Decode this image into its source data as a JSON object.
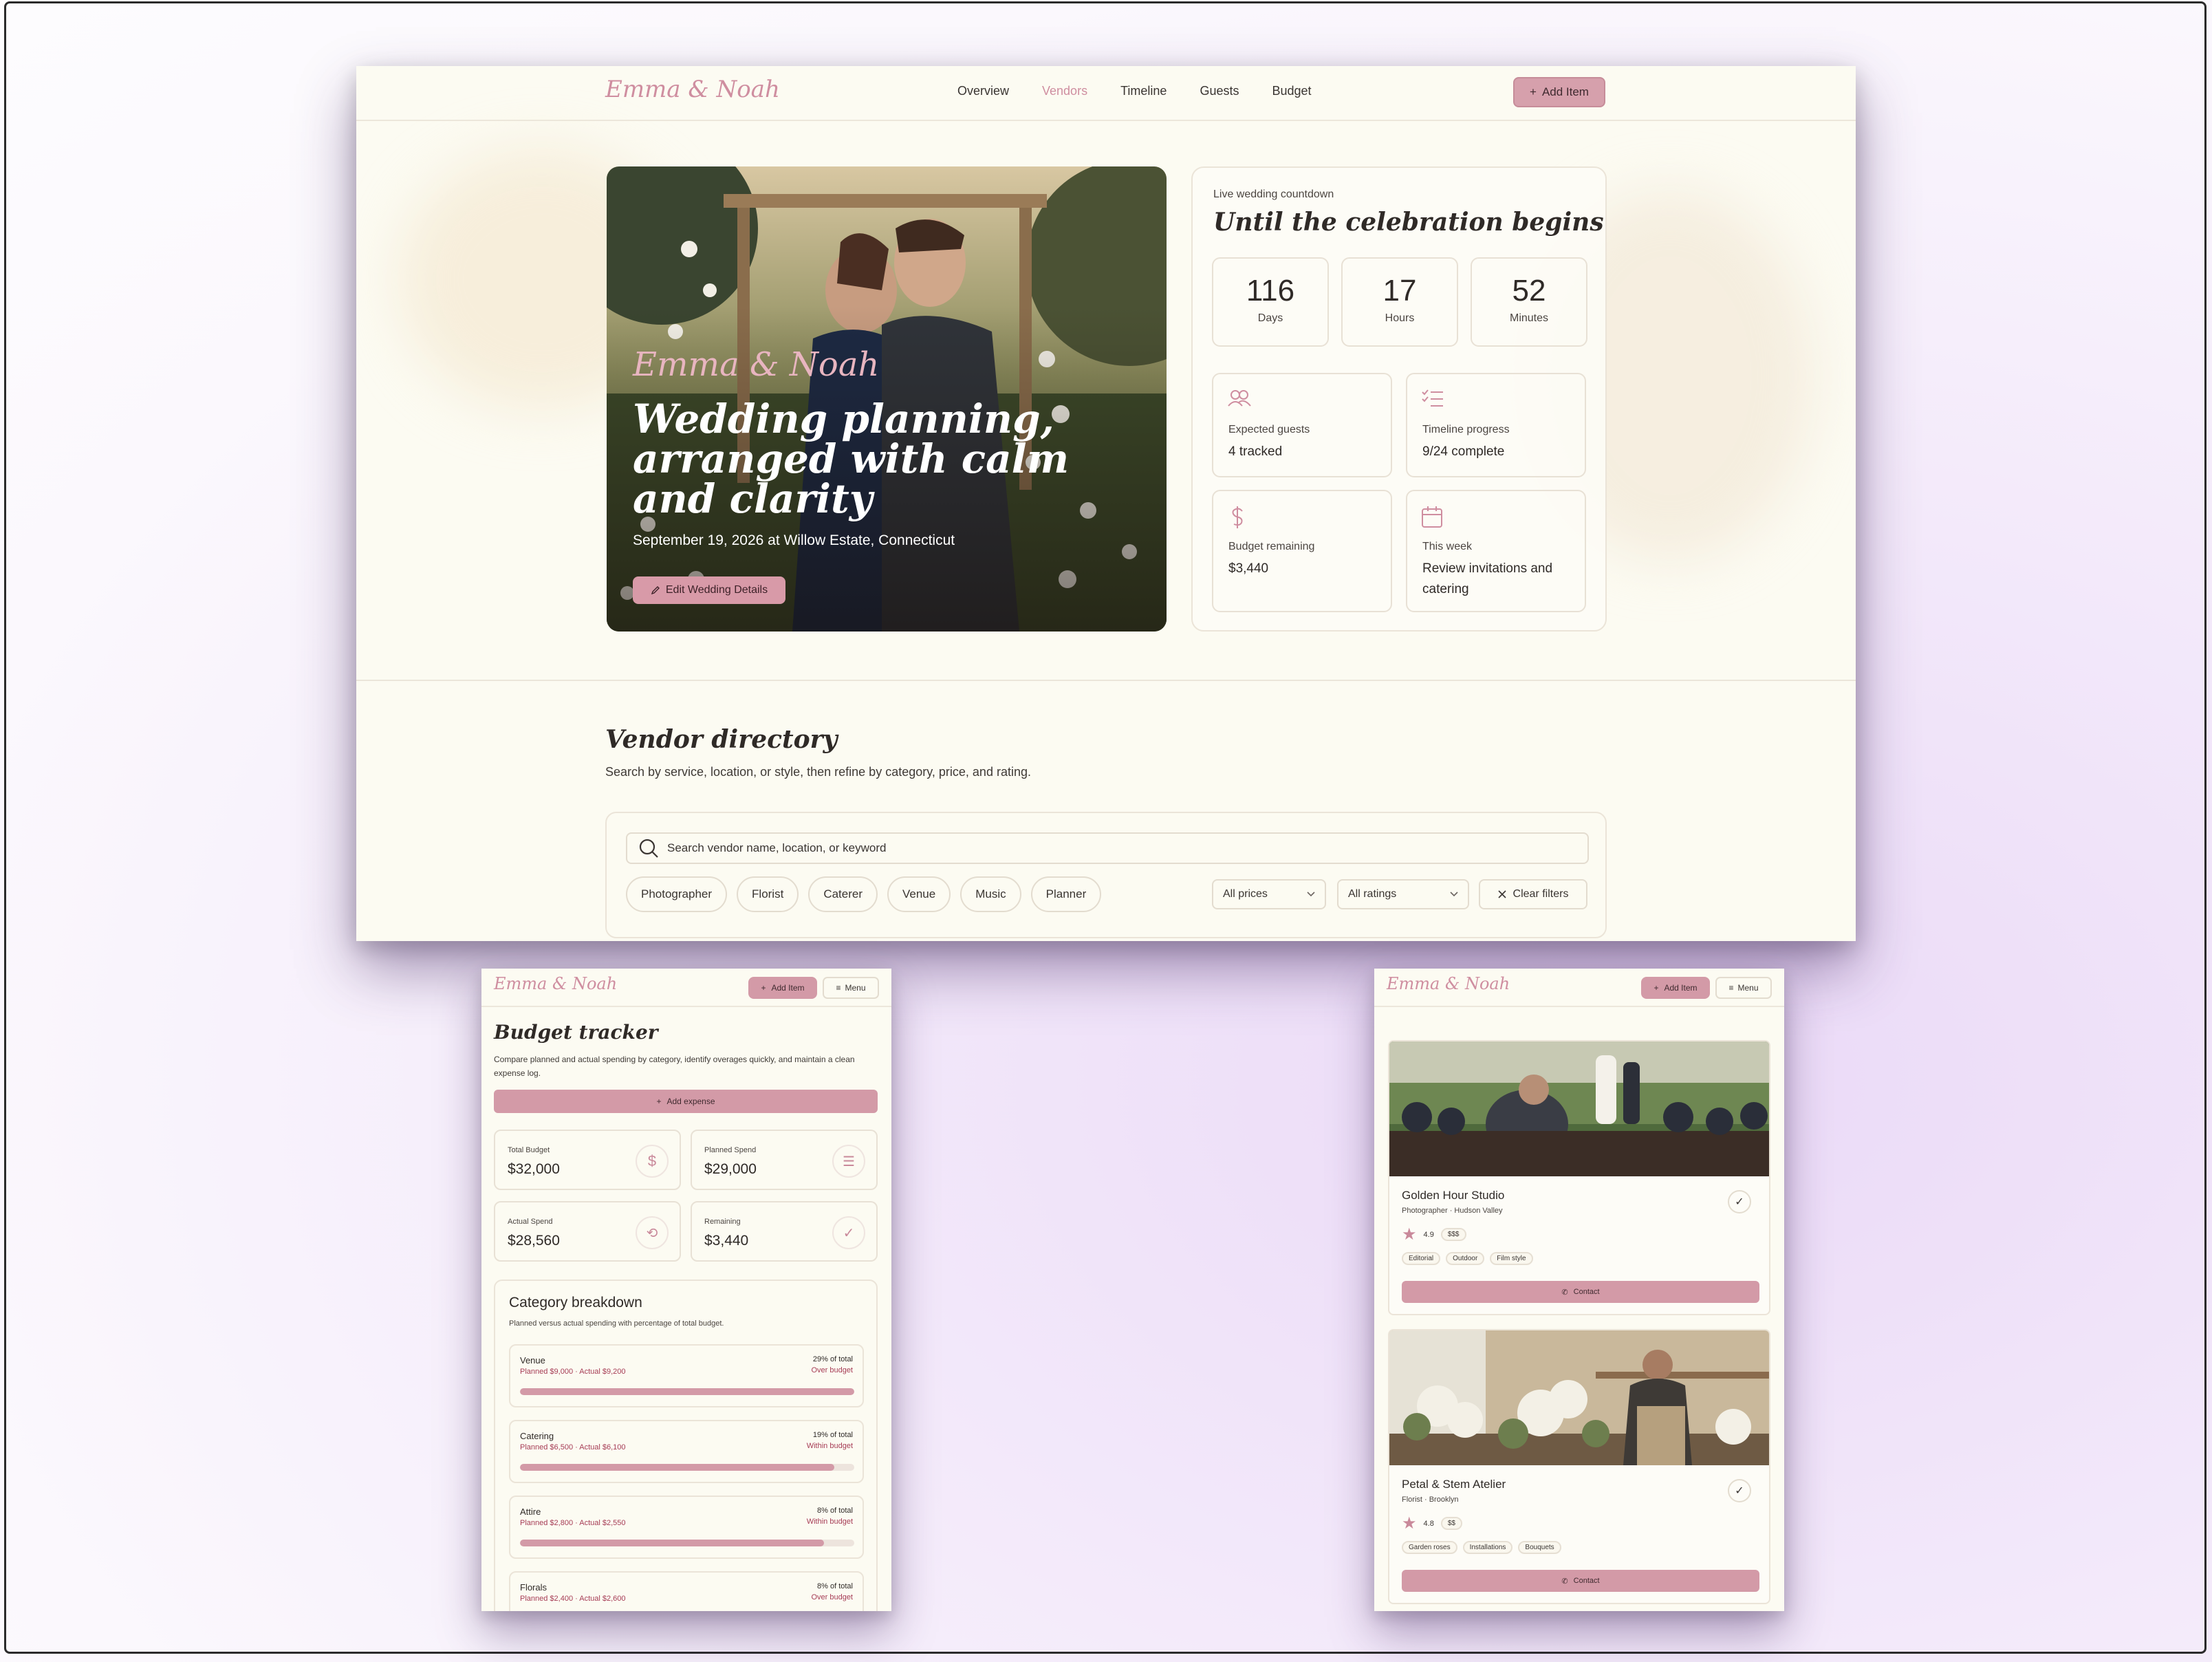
{
  "brand": "Emma & Noah",
  "nav": {
    "links": [
      "Overview",
      "Vendors",
      "Timeline",
      "Guests",
      "Budget"
    ],
    "active": "Vendors",
    "add_item": "Add Item"
  },
  "hero": {
    "couple": "Emma & Noah",
    "headline": "Wedding planning, arranged with calm and clarity",
    "date_location": "September 19, 2026 at Willow Estate, Connecticut",
    "edit_button": "Edit Wedding Details"
  },
  "countdown": {
    "eyebrow": "Live wedding countdown",
    "title": "Until the celebration begins",
    "days": {
      "value": "116",
      "unit": "Days"
    },
    "hours": {
      "value": "17",
      "unit": "Hours"
    },
    "minutes": {
      "value": "52",
      "unit": "Minutes"
    },
    "stats": {
      "guests": {
        "label": "Expected guests",
        "value": "4 tracked",
        "icon": "users-icon"
      },
      "timeline": {
        "label": "Timeline progress",
        "value": "9/24 complete",
        "icon": "checklist-icon"
      },
      "budget": {
        "label": "Budget remaining",
        "value": "$3,440",
        "icon": "dollar-icon"
      },
      "week": {
        "label": "This week",
        "value": "Review invitations and catering",
        "icon": "calendar-icon"
      }
    }
  },
  "vendor_directory": {
    "title": "Vendor directory",
    "subtitle": "Search by service, location, or style, then refine by category, price, and rating.",
    "search_placeholder": "Search vendor name, location, or keyword",
    "categories": [
      "Photographer",
      "Florist",
      "Caterer",
      "Venue",
      "Music",
      "Planner"
    ],
    "price_filter": "All prices",
    "rating_filter": "All ratings",
    "clear_filters": "Clear filters"
  },
  "mobile_menu_label": "Menu",
  "budget": {
    "title": "Budget tracker",
    "subtitle": "Compare planned and actual spending by category, identify overages quickly, and maintain a clean expense log.",
    "add_expense": "Add expense",
    "cards": {
      "total": {
        "label": "Total Budget",
        "value": "$32,000",
        "icon": "dollar-icon"
      },
      "planned": {
        "label": "Planned Spend",
        "value": "$29,000",
        "icon": "checklist-icon"
      },
      "actual": {
        "label": "Actual Spend",
        "value": "$28,560",
        "icon": "receipt-icon"
      },
      "remaining": {
        "label": "Remaining",
        "value": "$3,440",
        "icon": "check-circle-icon"
      }
    },
    "breakdown_title": "Category breakdown",
    "breakdown_subtitle": "Planned versus actual spending with percentage of total budget.",
    "categories": [
      {
        "name": "Venue",
        "detail": "Planned $9,000 · Actual $9,200",
        "percent": "29% of total",
        "status": "Over budget",
        "progress": 1.0
      },
      {
        "name": "Catering",
        "detail": "Planned $6,500 · Actual $6,100",
        "percent": "19% of total",
        "status": "Within budget",
        "progress": 0.94
      },
      {
        "name": "Attire",
        "detail": "Planned $2,800 · Actual $2,550",
        "percent": "8% of total",
        "status": "Within budget",
        "progress": 0.91
      },
      {
        "name": "Florals",
        "detail": "Planned $2,400 · Actual $2,600",
        "percent": "8% of total",
        "status": "Over budget",
        "progress": 1.0
      }
    ]
  },
  "vendors": [
    {
      "name": "Golden Hour Studio",
      "location": "Photographer · Hudson Valley",
      "rating": "4.9",
      "price": "$$$",
      "tags": [
        "Editorial",
        "Outdoor",
        "Film style"
      ],
      "contact": "Contact"
    },
    {
      "name": "Petal & Stem Atelier",
      "location": "Florist · Brooklyn",
      "rating": "4.8",
      "price": "$$",
      "tags": [
        "Garden roses",
        "Installations",
        "Bouquets"
      ],
      "contact": "Contact"
    }
  ],
  "colors": {
    "accent": "#d39aa7",
    "brand_script": "#cf8ea0",
    "background": "#fcfbf2",
    "alert": "#a63c55"
  }
}
